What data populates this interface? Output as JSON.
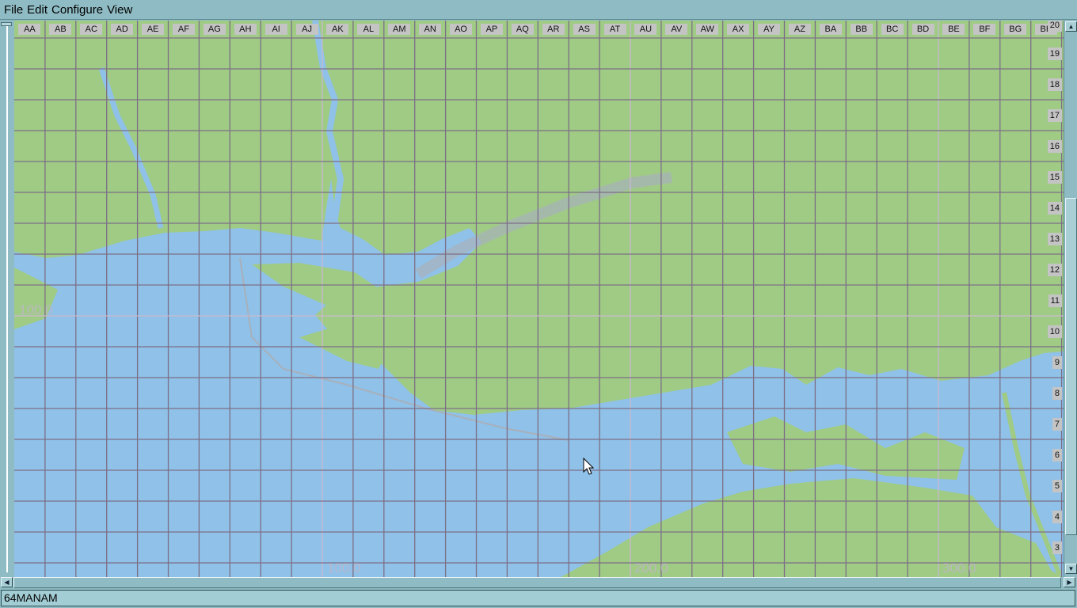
{
  "menu": [
    "File",
    "Edit",
    "Configure",
    "View"
  ],
  "columns": [
    "AA",
    "AB",
    "AC",
    "AD",
    "AE",
    "AF",
    "AG",
    "AH",
    "AI",
    "AJ",
    "AK",
    "AL",
    "AM",
    "AN",
    "AO",
    "AP",
    "AQ",
    "AR",
    "AS",
    "AT",
    "AU",
    "AV",
    "AW",
    "AX",
    "AY",
    "AZ",
    "BA",
    "BB",
    "BC",
    "BD",
    "BE",
    "BF",
    "BG",
    "BH"
  ],
  "rows": [
    "20",
    "19",
    "18",
    "17",
    "16",
    "15",
    "14",
    "13",
    "12",
    "11",
    "10",
    "9",
    "8",
    "7",
    "6",
    "5",
    "4",
    "3"
  ],
  "grid_labels": {
    "x": [
      "100.0",
      "200.0",
      "300.0"
    ],
    "y": [
      "100.0"
    ]
  },
  "status_text": "64MANAM",
  "colors": {
    "land": "#9fcb85",
    "water": "#8fc1e9",
    "grid": "#7d6f86",
    "chrome": "#8fbcc4"
  }
}
